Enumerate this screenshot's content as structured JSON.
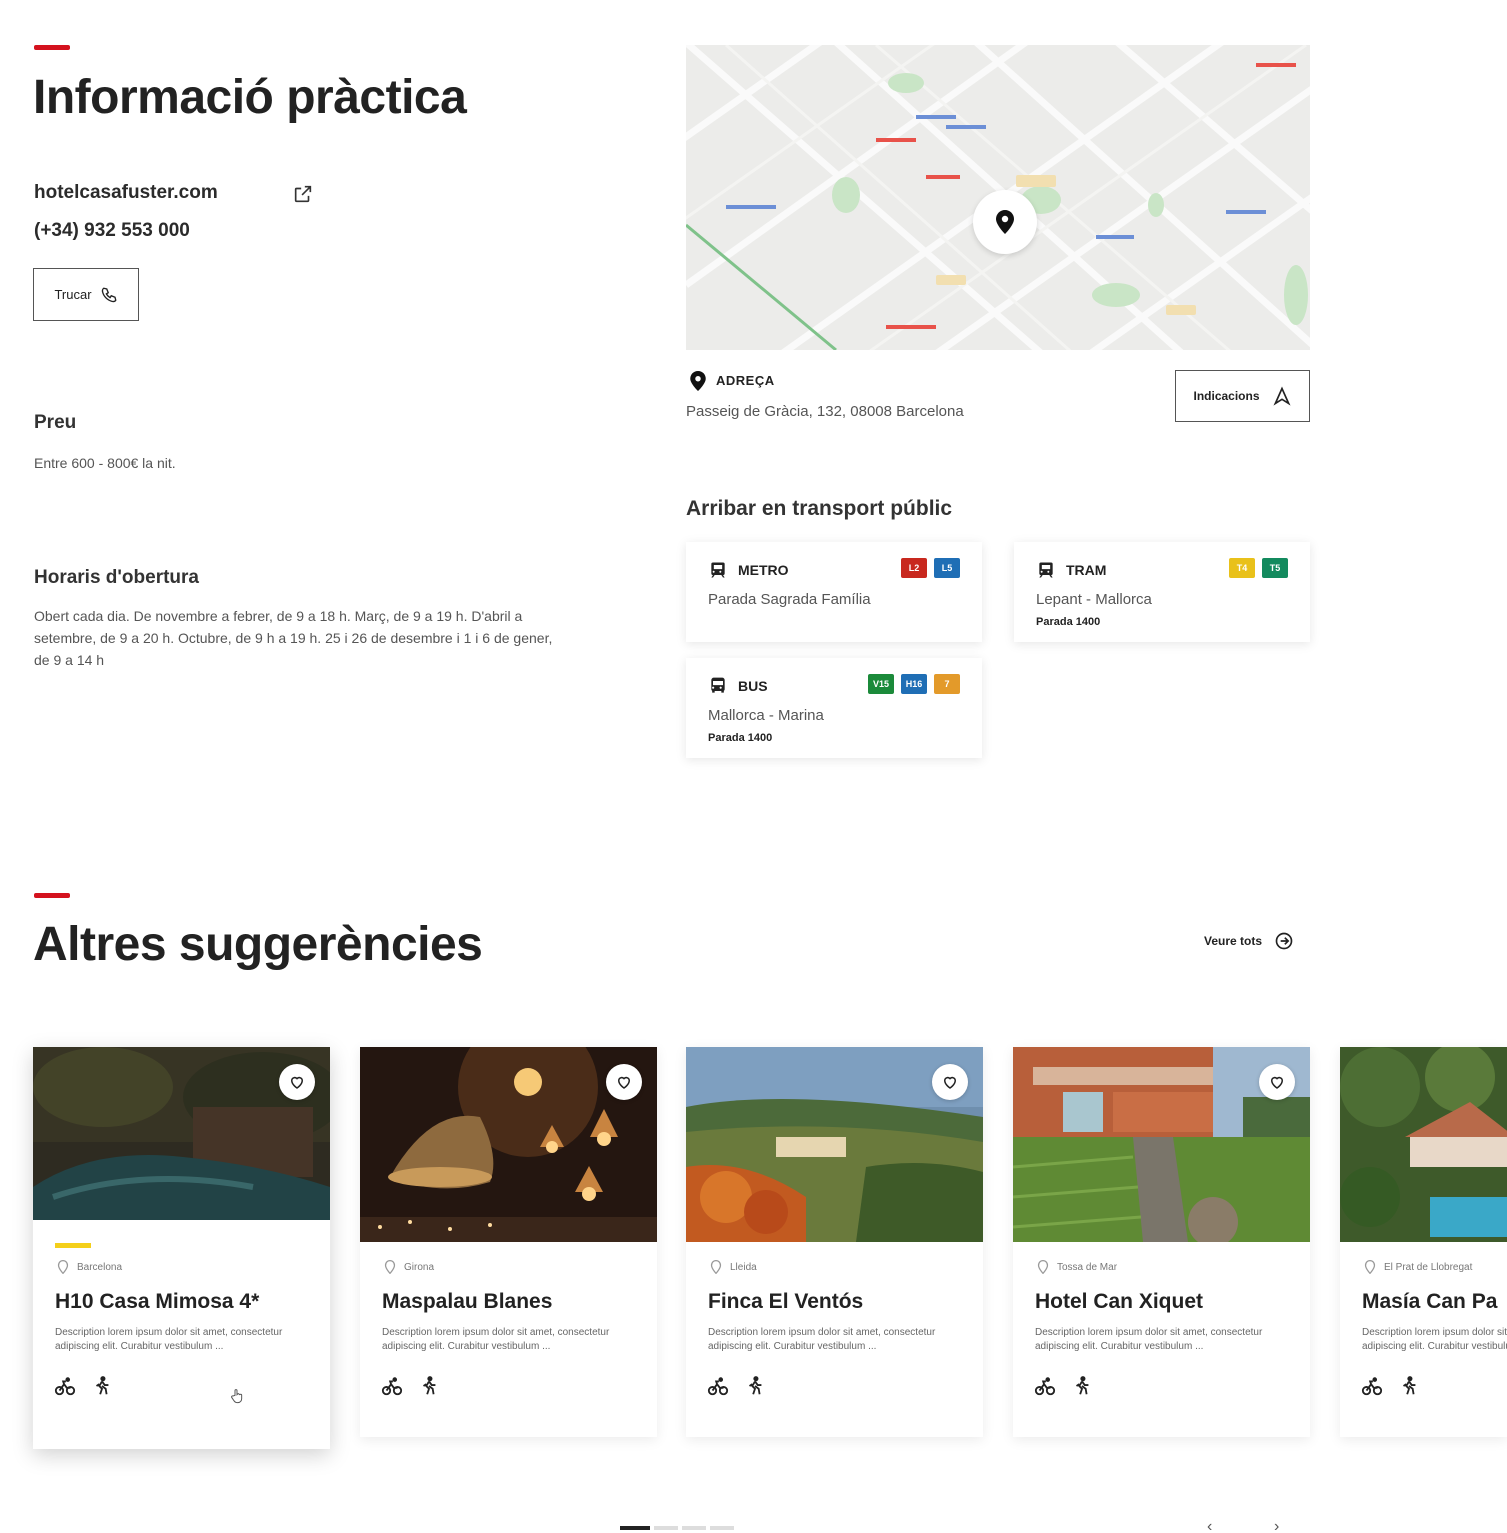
{
  "info": {
    "title": "Informació pràctica",
    "website": "hotelcasafuster.com",
    "phone": "(+34) 932 553 000",
    "call_button": "Trucar",
    "price_heading": "Preu",
    "price_text": "Entre 600 - 800€ la nit.",
    "hours_heading": "Horaris d'obertura",
    "hours_text": "Obert cada dia. De novembre a febrer, de 9 a 18 h. Març, de 9 a 19 h. D'abril a setembre, de 9 a 20 h. Octubre, de 9 h a 19 h. 25 i 26 de desembre i 1 i 6 de gener, de 9 a 14 h"
  },
  "address": {
    "label": "ADREÇA",
    "text": "Passeig de Gràcia, 132, 08008 Barcelona",
    "directions_button": "Indicacions"
  },
  "transport": {
    "title": "Arribar en transport públic",
    "cards": [
      {
        "type": "METRO",
        "line": "Parada Sagrada Família",
        "stop": "",
        "badges": [
          {
            "text": "L2",
            "color": "#c8281e"
          },
          {
            "text": "L5",
            "color": "#1f6eb5"
          }
        ]
      },
      {
        "type": "TRAM",
        "line": "Lepant - Mallorca",
        "stop": "Parada 1400",
        "badges": [
          {
            "text": "T4",
            "color": "#e9c11a"
          },
          {
            "text": "T5",
            "color": "#138a5e"
          }
        ]
      },
      {
        "type": "BUS",
        "line": "Mallorca - Marina",
        "stop": "Parada 1400",
        "badges": [
          {
            "text": "V15",
            "color": "#1b8a3a"
          },
          {
            "text": "H16",
            "color": "#1f6eb5"
          },
          {
            "text": "7",
            "color": "#e39a2a"
          }
        ]
      }
    ]
  },
  "suggestions": {
    "title": "Altres suggerències",
    "see_all": "Veure tots",
    "cards": [
      {
        "location": "Barcelona",
        "title": "H10 Casa Mimosa 4*",
        "desc": "Description lorem ipsum dolor sit amet, consectetur adipiscing elit. Curabitur vestibulum ..."
      },
      {
        "location": "Girona",
        "title": "Maspalau Blanes",
        "desc": "Description lorem ipsum dolor sit amet, consectetur adipiscing elit. Curabitur vestibulum ..."
      },
      {
        "location": "Lleida",
        "title": "Finca El Ventós",
        "desc": "Description lorem ipsum dolor sit amet, consectetur adipiscing elit. Curabitur vestibulum ..."
      },
      {
        "location": "Tossa de Mar",
        "title": "Hotel Can Xiquet",
        "desc": "Description lorem ipsum dolor sit amet, consectetur adipiscing elit. Curabitur vestibulum ..."
      },
      {
        "location": "El Prat de Llobregat",
        "title": "Masía Can Pa",
        "desc": "Description lorem ipsum dolor sit amet, consectetur adipiscing elit. Curabitur vestibulum ..."
      }
    ]
  },
  "colors": {
    "accent": "#d4121e",
    "yellow": "#f4cf1a"
  },
  "icons": [
    "external-link-icon",
    "phone-icon",
    "map-pin-icon",
    "directions-icon",
    "train-icon",
    "bus-icon",
    "heart-icon",
    "bike-icon",
    "hiking-icon",
    "arrow-circle-icon"
  ]
}
